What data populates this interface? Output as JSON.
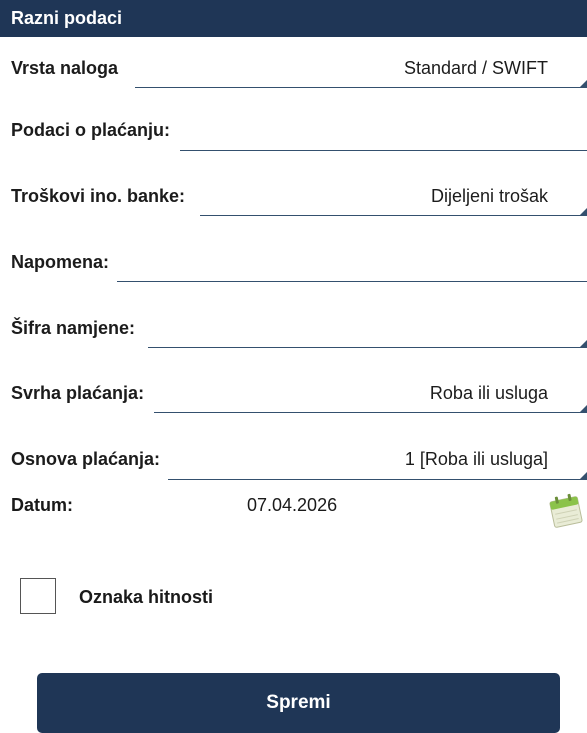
{
  "header": {
    "title": "Razni podaci"
  },
  "fields": [
    {
      "label": "Vrsta naloga",
      "value": "Standard / SWIFT",
      "dropdown": true
    },
    {
      "label": "Podaci o plaćanju:",
      "value": "",
      "dropdown": false
    },
    {
      "label": "Troškovi ino. banke:",
      "value": "Dijeljeni trošak",
      "dropdown": true
    },
    {
      "label": "Napomena:",
      "value": "",
      "dropdown": false
    },
    {
      "label": "Šifra namjene:",
      "value": "",
      "dropdown": true
    },
    {
      "label": "Svrha plaćanja:",
      "value": "Roba ili usluga",
      "dropdown": true
    },
    {
      "label": "Osnova plaćanja:",
      "value": "1 [Roba ili usluga]",
      "dropdown": true
    }
  ],
  "date": {
    "label": "Datum:",
    "value": "07.04.2026",
    "icon": "calendar-icon"
  },
  "urgency": {
    "label": "Oznaka hitnosti",
    "checked": false
  },
  "actions": {
    "save_label": "Spremi"
  },
  "colors": {
    "primary": "#1f3656",
    "line": "#34506e"
  }
}
